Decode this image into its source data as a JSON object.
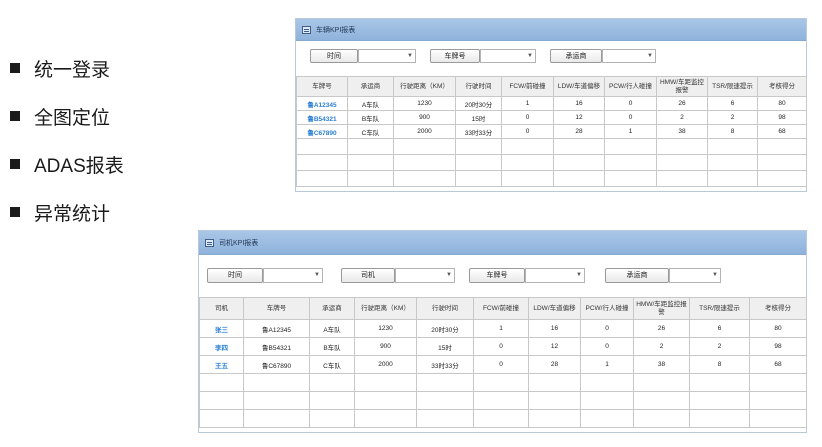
{
  "bullets": [
    {
      "label": "统一登录"
    },
    {
      "label": "全图定位"
    },
    {
      "label": "ADAS报表"
    },
    {
      "label": "异常统计"
    }
  ],
  "vehicle_report": {
    "title": "车辆KPI报表",
    "filters": [
      {
        "label": "时间",
        "value": ""
      },
      {
        "label": "车牌号",
        "value": ""
      },
      {
        "label": "承运商",
        "value": ""
      }
    ],
    "columns": [
      "车牌号",
      "承运商",
      "行驶距离（KM）",
      "行驶时间",
      "FCW/前碰撞",
      "LDW/车道偏移",
      "PCW/行人碰撞",
      "HMW/车距监控报警",
      "TSR/限速提示",
      "考核得分"
    ],
    "rows": [
      [
        "鲁A12345",
        "A车队",
        "1230",
        "20时30分",
        "1",
        "16",
        "0",
        "26",
        "6",
        "80"
      ],
      [
        "鲁B54321",
        "B车队",
        "900",
        "15时",
        "0",
        "12",
        "0",
        "2",
        "2",
        "98"
      ],
      [
        "鲁C67890",
        "C车队",
        "2000",
        "33时33分",
        "0",
        "28",
        "1",
        "38",
        "8",
        "68"
      ]
    ]
  },
  "driver_report": {
    "title": "司机KPI报表",
    "filters": [
      {
        "label": "时间",
        "value": ""
      },
      {
        "label": "司机",
        "value": ""
      },
      {
        "label": "车牌号",
        "value": ""
      },
      {
        "label": "承运商",
        "value": ""
      }
    ],
    "columns": [
      "司机",
      "车牌号",
      "承运商",
      "行驶距离（KM）",
      "行驶时间",
      "FCW/前碰撞",
      "LDW/车道偏移",
      "PCW/行人碰撞",
      "HMW/车距监控报警",
      "TSR/限速提示",
      "考核得分"
    ],
    "rows": [
      [
        "张三",
        "鲁A12345",
        "A车队",
        "1230",
        "20时30分",
        "1",
        "16",
        "0",
        "26",
        "6",
        "80"
      ],
      [
        "李四",
        "鲁B54321",
        "B车队",
        "900",
        "15时",
        "0",
        "12",
        "0",
        "2",
        "2",
        "98"
      ],
      [
        "王五",
        "鲁C67890",
        "C车队",
        "2000",
        "33时33分",
        "0",
        "28",
        "1",
        "38",
        "8",
        "68"
      ]
    ]
  },
  "icons": {
    "dropdown": "chevron-down-icon",
    "panel": "table-icon"
  },
  "colors": {
    "header_bg": "#9bbde3",
    "link": "#2a7fd4",
    "table_head_bg": "#efefef"
  }
}
